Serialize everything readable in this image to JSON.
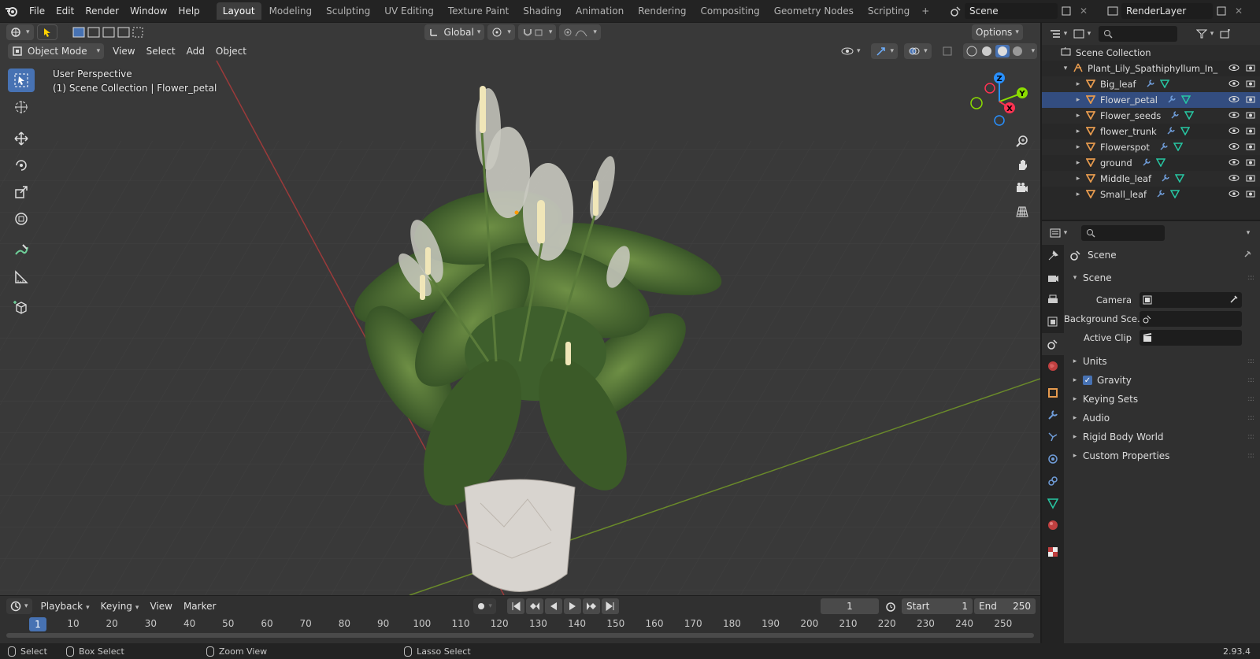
{
  "menus": [
    "File",
    "Edit",
    "Render",
    "Window",
    "Help"
  ],
  "workspace_tabs": [
    "Layout",
    "Modeling",
    "Sculpting",
    "UV Editing",
    "Texture Paint",
    "Shading",
    "Animation",
    "Rendering",
    "Compositing",
    "Geometry Nodes",
    "Scripting"
  ],
  "active_workspace": "Layout",
  "scene_name": "Scene",
  "view_layer": "RenderLayer",
  "viewport": {
    "mode": "Object Mode",
    "menus": [
      "View",
      "Select",
      "Add",
      "Object"
    ],
    "transform_orientation": "Global",
    "options_label": "Options",
    "perspective": "User Perspective",
    "collection_info": "(1) Scene Collection | Flower_petal",
    "gizmo_axes": {
      "z": "Z",
      "y": "Y",
      "x": "X"
    }
  },
  "outliner": {
    "root": "Scene Collection",
    "collection": "Plant_Lily_Spathiphyllum_In_",
    "objects": [
      "Big_leaf",
      "Flower_petal",
      "Flower_seeds",
      "flower_trunk",
      "Flowerspot",
      "ground",
      "Middle_leaf",
      "Small_leaf"
    ],
    "selected": "Flower_petal"
  },
  "properties": {
    "context_title": "Scene",
    "panel_title": "Scene",
    "fields": [
      {
        "label": "Camera",
        "value": ""
      },
      {
        "label": "Background Sce...",
        "value": ""
      },
      {
        "label": "Active Clip",
        "value": ""
      }
    ],
    "subpanels": [
      "Units",
      "Gravity",
      "Keying Sets",
      "Audio",
      "Rigid Body World",
      "Custom Properties"
    ],
    "gravity_checked": true
  },
  "timeline": {
    "menus": [
      "Playback",
      "Keying",
      "View",
      "Marker"
    ],
    "current_frame": "1",
    "start_label": "Start",
    "start": "1",
    "end_label": "End",
    "end": "250",
    "ticks": [
      "10",
      "20",
      "30",
      "40",
      "50",
      "60",
      "70",
      "80",
      "90",
      "100",
      "110",
      "120",
      "130",
      "140",
      "150",
      "160",
      "170",
      "180",
      "190",
      "200",
      "210",
      "220",
      "230",
      "240",
      "250"
    ]
  },
  "statusbar": {
    "items": [
      "Select",
      "Box Select",
      "Zoom View",
      "Lasso Select"
    ],
    "version": "2.93.4"
  },
  "colors": {
    "accent": "#4772b3",
    "axis_x": "#ff3352",
    "axis_y": "#8bdc00",
    "axis_z": "#2890ff",
    "mesh_icon": "#e69a4e",
    "modifier_icon": "#6f9cd8",
    "data_icon": "#27c7a3"
  }
}
